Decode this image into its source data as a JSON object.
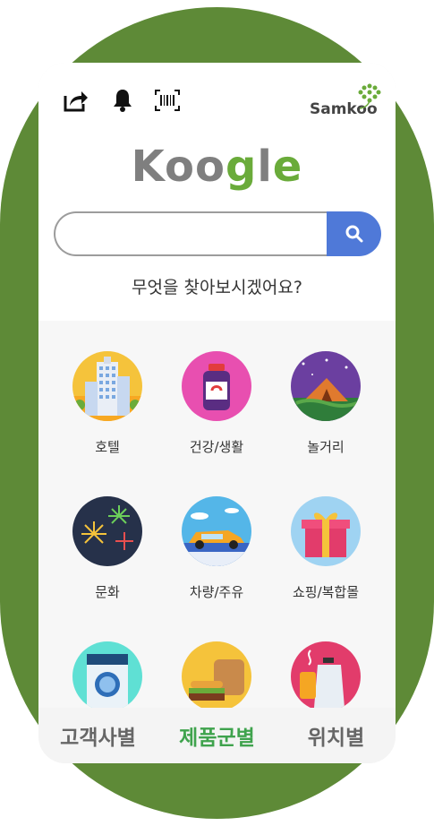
{
  "header": {
    "share_icon": "share-icon",
    "bell_icon": "bell-icon",
    "barcode_icon": "barcode-icon",
    "brand_name": "Samkoo"
  },
  "logo": {
    "part1": "Koo",
    "part2": "g",
    "part3": "l",
    "part4": "e"
  },
  "search": {
    "placeholder": "",
    "value": "",
    "button_icon": "search-icon"
  },
  "prompt": "무엇을 찾아보시겠어요?",
  "categories": [
    {
      "label": "호텔",
      "icon": "hotel-icon"
    },
    {
      "label": "건강/생활",
      "icon": "health-icon"
    },
    {
      "label": "놀거리",
      "icon": "camping-icon"
    },
    {
      "label": "문화",
      "icon": "fireworks-icon"
    },
    {
      "label": "차량/주유",
      "icon": "car-icon"
    },
    {
      "label": "쇼핑/복합몰",
      "icon": "gift-icon"
    },
    {
      "label": "",
      "icon": "washer-icon"
    },
    {
      "label": "",
      "icon": "food-icon"
    },
    {
      "label": "",
      "icon": "kitchen-icon"
    }
  ],
  "tabs": [
    {
      "label": "고객사별",
      "active": false
    },
    {
      "label": "제품군별",
      "active": true
    },
    {
      "label": "위치별",
      "active": false
    }
  ],
  "colors": {
    "green": "#5e8a37",
    "accent_blue": "#4f79d8",
    "active_tab": "#3fa34d"
  }
}
